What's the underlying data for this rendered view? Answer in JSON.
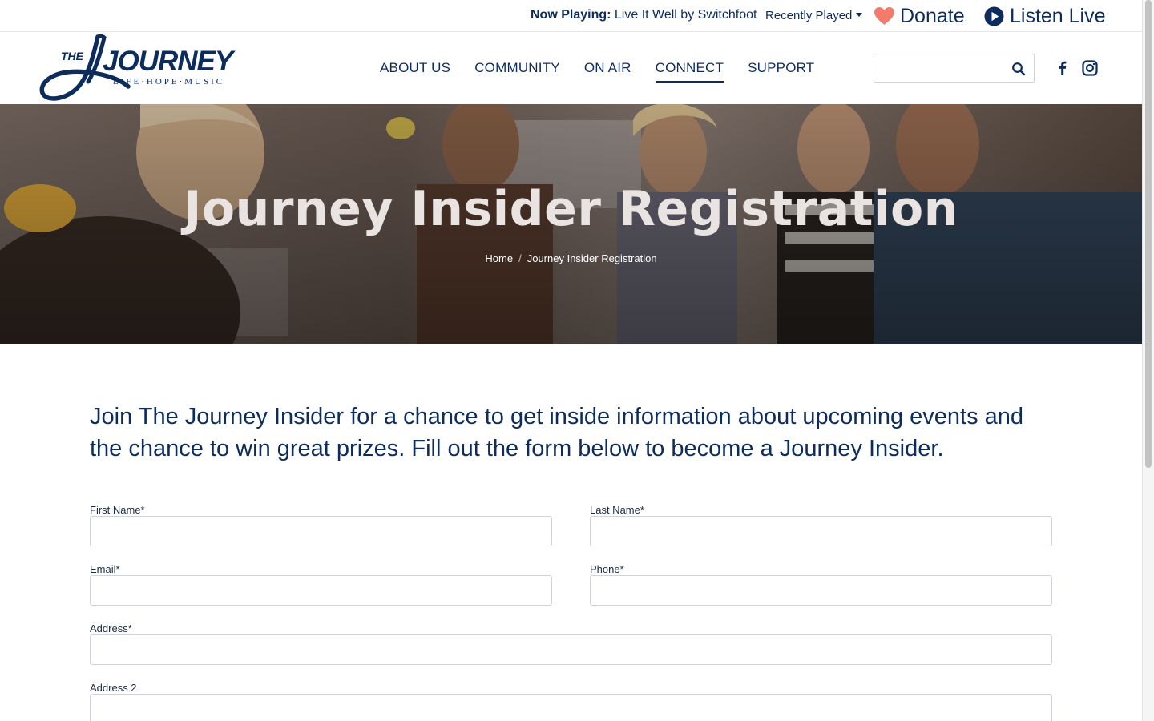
{
  "topbar": {
    "now_playing_label": "Now Playing:",
    "now_playing_track": "Live It Well by Switchfoot",
    "recently_played": "Recently Played",
    "donate": "Donate",
    "listen_live": "Listen Live"
  },
  "logo": {
    "the": "THE",
    "name": "JOURNEY",
    "tagline": "LIFE·HOPE·MUSIC"
  },
  "nav": {
    "items": [
      {
        "label": "ABOUT US"
      },
      {
        "label": "COMMUNITY"
      },
      {
        "label": "ON AIR"
      },
      {
        "label": "CONNECT"
      },
      {
        "label": "SUPPORT"
      }
    ],
    "active": "CONNECT"
  },
  "search": {
    "placeholder": "",
    "value": ""
  },
  "social": {
    "icons": [
      "facebook-icon",
      "instagram-icon"
    ]
  },
  "hero": {
    "title": "Journey Insider Registration",
    "breadcrumb": {
      "home": "Home",
      "separator": "/",
      "current": "Journey Insider Registration"
    }
  },
  "intro": {
    "text": "Join The Journey Insider for a chance to get inside information about upcoming events and the chance to win great prizes. Fill out the form below to become a Journey Insider."
  },
  "form": {
    "first_name_label": "First Name*",
    "last_name_label": "Last Name*",
    "email_label": "Email*",
    "phone_label": "Phone*",
    "address_label": "Address*",
    "address2_label": "Address 2",
    "first_name_value": "",
    "last_name_value": "",
    "email_value": "",
    "phone_value": "",
    "address_value": "",
    "address2_value": ""
  },
  "colors": {
    "brand_navy": "#0d2c5e",
    "donate_heart": "#f37b6b",
    "hero_title": "#e9e4e2",
    "input_border": "#cfd3d8"
  }
}
